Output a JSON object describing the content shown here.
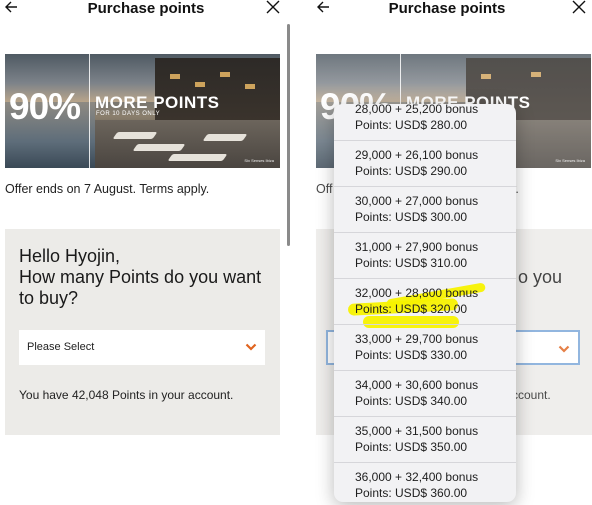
{
  "header": {
    "title": "Purchase points"
  },
  "banner": {
    "percent": "90%",
    "headline": "MORE POINTS",
    "subline": "FOR 10 DAYS ONLY",
    "brand": "Six Senses Ibiza"
  },
  "offer_text": "Offer ends on 7 August. Terms apply.",
  "greeting": {
    "line1": "Hello Hyojin,",
    "line2": "How many Points do you want to buy?"
  },
  "select": {
    "value": "Please Select"
  },
  "balance_text": "You have 42,048 Points in your account.",
  "right_partial": {
    "offer_fragment": "Off",
    "offer_tail": "y.",
    "greet_tail": "o you",
    "balance_tail": "ccount."
  },
  "dropdown": {
    "options": [
      {
        "line1": "28,000 + 25,200 bonus",
        "line2": "Points: USD$ 280.00"
      },
      {
        "line1": "29,000 + 26,100 bonus",
        "line2": "Points: USD$ 290.00"
      },
      {
        "line1": "30,000 + 27,000 bonus",
        "line2": "Points: USD$ 300.00"
      },
      {
        "line1": "31,000 + 27,900 bonus",
        "line2": "Points: USD$ 310.00"
      },
      {
        "line1": "32,000 + 28,800 bonus",
        "line2": "Points: USD$ 320.00"
      },
      {
        "line1": "33,000 + 29,700 bonus",
        "line2": "Points: USD$ 330.00"
      },
      {
        "line1": "34,000 + 30,600 bonus",
        "line2": "Points: USD$ 340.00"
      },
      {
        "line1": "35,000 + 31,500 bonus",
        "line2": "Points: USD$ 350.00"
      },
      {
        "line1": "36,000 + 32,400 bonus",
        "line2": "Points: USD$ 360.00"
      }
    ]
  },
  "colors": {
    "accent": "#e0641f",
    "card_bg": "#ecebe8",
    "highlight": "#f7f200",
    "focus_border": "#7aa7d8"
  },
  "icons": {
    "back": "arrow-left-icon",
    "close": "close-icon",
    "chevron": "chevron-down-icon"
  }
}
